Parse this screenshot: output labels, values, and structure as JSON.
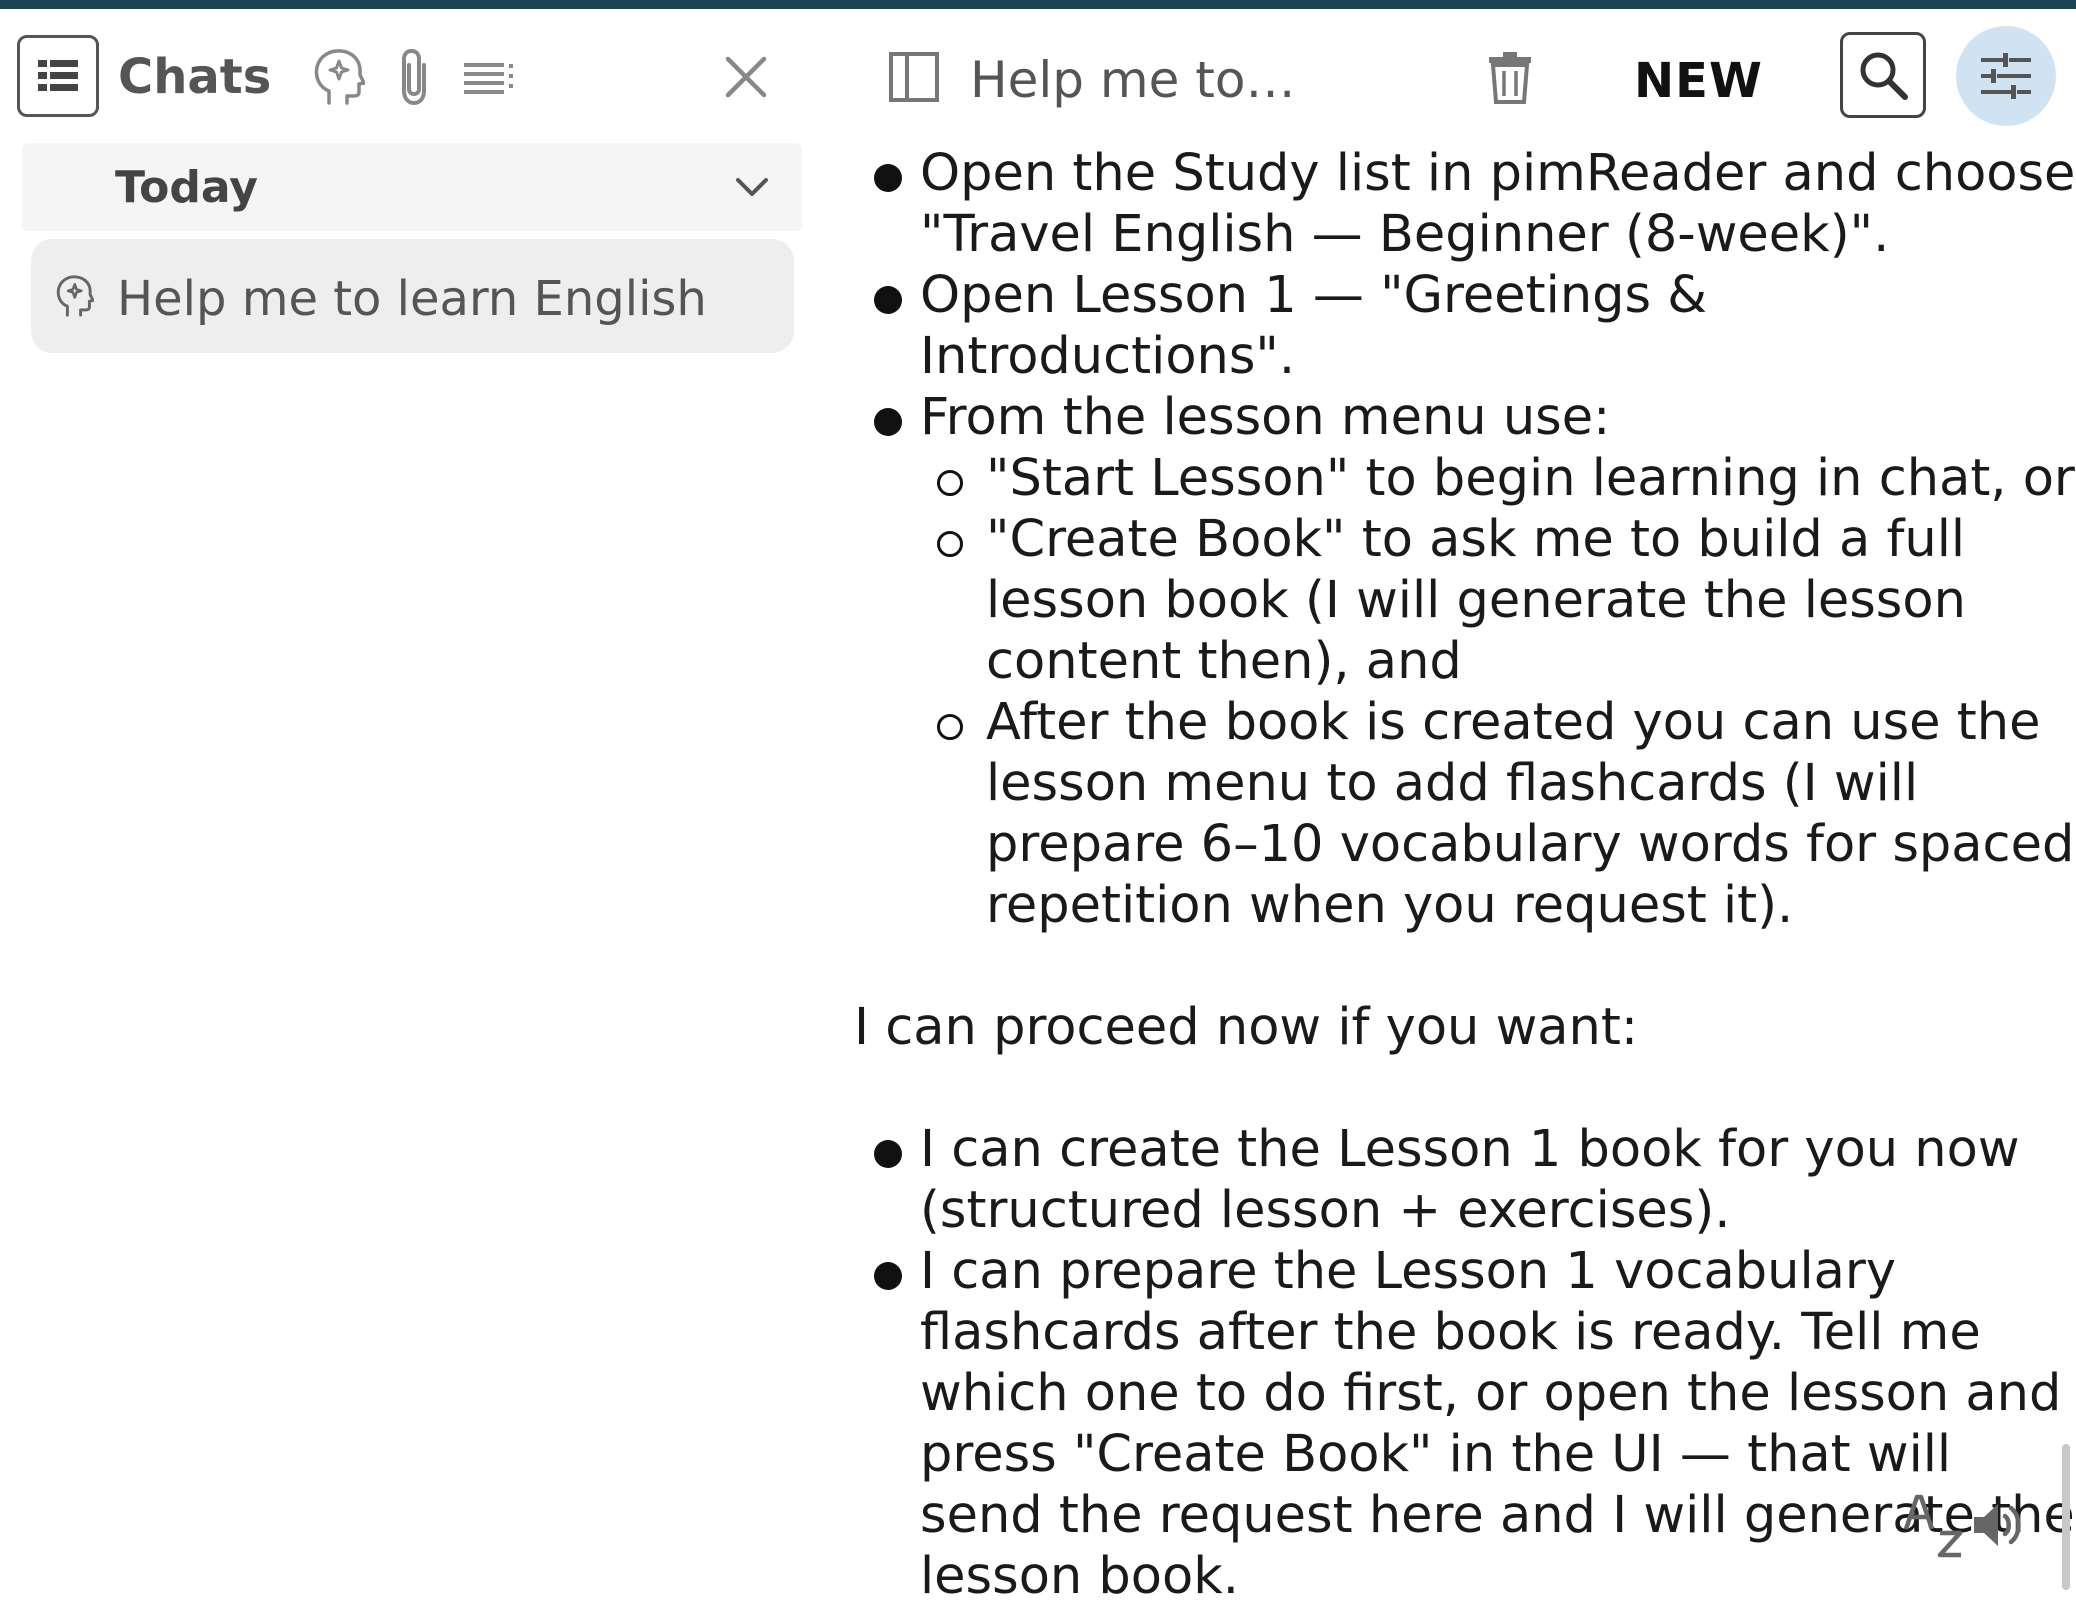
{
  "sidebar": {
    "title": "Chats",
    "section_label": "Today",
    "chat_item_label": "Help me to learn English"
  },
  "main": {
    "chat_title": "Help me to learn English",
    "new_label": "NEW",
    "message": {
      "list1": [
        {
          "text": "Open the Study list in pimReader and choose \"Travel English — Beginner (8-week)\"."
        },
        {
          "text": "Open Lesson 1 — \"Greetings & Introductions\"."
        },
        {
          "text": "From the lesson menu use:",
          "sub": [
            "\"Start Lesson\" to begin learning in chat, or",
            "\"Create Book\" to ask me to build a full lesson book (I will generate the lesson content then), and",
            "After the book is created you can use the lesson menu to add flashcards (I will prepare 6–10 vocabulary words for spaced repetition when you request it)."
          ]
        }
      ],
      "paragraph": "I can proceed now if you want:",
      "list2": [
        "I can create the Lesson 1 book for you now (structured lesson + exercises).",
        "I can prepare the Lesson 1 vocabulary flashcards after the book is ready. Tell me which one to do first, or open the lesson and press \"Create Book\" in the UI — that will send the request here and I will generate the lesson book."
      ]
    }
  },
  "colors": {
    "top_bar": "#1d4453",
    "settings_circle": "#cfe3f3",
    "item_bg": "#eeeeee"
  }
}
